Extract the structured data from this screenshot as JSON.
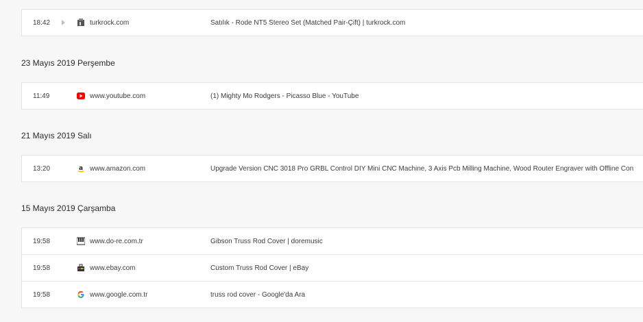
{
  "top_group": {
    "rows": [
      {
        "time": "18:42",
        "domain": "turkrock.com",
        "title": "Satılık - Rode NT5 Stereo Set (Matched Pair-Çift) | turkrock.com",
        "icon": "turkrock-favicon-icon"
      }
    ]
  },
  "groups": [
    {
      "date": "23 Mayıs 2019 Perşembe",
      "rows": [
        {
          "time": "11:49",
          "domain": "www.youtube.com",
          "title": "(1) Mighty Mo Rodgers - Picasso Blue - YouTube",
          "icon": "youtube-icon"
        }
      ]
    },
    {
      "date": "21 Mayıs 2019 Salı",
      "rows": [
        {
          "time": "13:20",
          "domain": "www.amazon.com",
          "title": "Upgrade Version CNC 3018 Pro GRBL Control DIY Mini CNC Machine, 3 Axis Pcb Milling Machine, Wood Router Engraver with Offline Con",
          "icon": "amazon-icon"
        }
      ]
    },
    {
      "date": "15 Mayıs 2019 Çarşamba",
      "rows": [
        {
          "time": "19:58",
          "domain": "www.do-re.com.tr",
          "title": "Gibson Truss Rod Cover | doremusic",
          "icon": "do-re-icon"
        },
        {
          "time": "19:58",
          "domain": "www.ebay.com",
          "title": "Custom Truss Rod Cover | eBay",
          "icon": "ebay-icon"
        },
        {
          "time": "19:58",
          "domain": "www.google.com.tr",
          "title": "truss rod cover - Google'da Ara",
          "icon": "google-icon"
        }
      ]
    }
  ],
  "colors": {
    "background": "#f7f7f7",
    "card": "#ffffff",
    "youtube": "#ff0000",
    "amazon_smile": "#ff9900"
  }
}
